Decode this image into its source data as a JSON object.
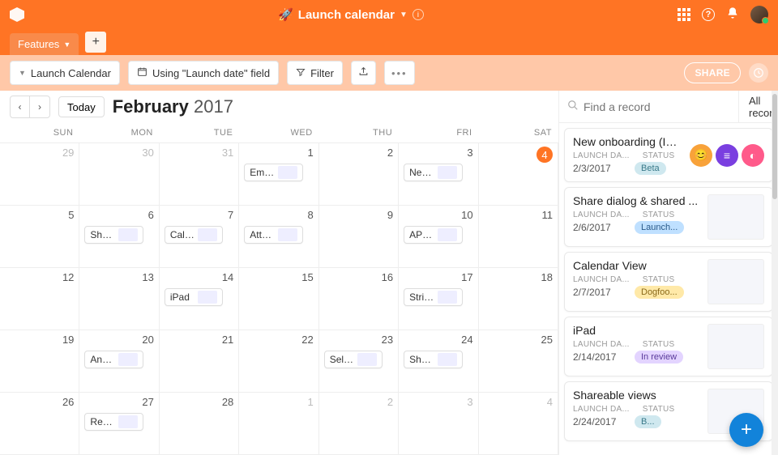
{
  "topbar": {
    "title": "Launch calendar",
    "rocket": "🚀"
  },
  "tabs": {
    "features": "Features",
    "add": "+"
  },
  "toolbar": {
    "view_name": "Launch Calendar",
    "using_field": "Using \"Launch date\" field",
    "filter": "Filter",
    "share": "SHARE"
  },
  "cal": {
    "today": "Today",
    "month": "February",
    "year": "2017",
    "dow": [
      "SUN",
      "MON",
      "TUE",
      "WED",
      "THU",
      "FRI",
      "SAT"
    ],
    "cells": [
      {
        "n": "29",
        "off": true
      },
      {
        "n": "30",
        "off": true
      },
      {
        "n": "31",
        "off": true
      },
      {
        "n": "1",
        "ev": "Embed..."
      },
      {
        "n": "2"
      },
      {
        "n": "3",
        "ev": "New o..."
      },
      {
        "n": "4",
        "today": true
      },
      {
        "n": "5"
      },
      {
        "n": "6",
        "ev": "Share ..."
      },
      {
        "n": "7",
        "ev": "Calend..."
      },
      {
        "n": "8",
        "ev": "Attach..."
      },
      {
        "n": "9"
      },
      {
        "n": "10",
        "ev": "API Im..."
      },
      {
        "n": "11"
      },
      {
        "n": "12"
      },
      {
        "n": "13"
      },
      {
        "n": "14",
        "ev": "iPad"
      },
      {
        "n": "15"
      },
      {
        "n": "16"
      },
      {
        "n": "17",
        "ev": "String ..."
      },
      {
        "n": "18"
      },
      {
        "n": "19"
      },
      {
        "n": "20",
        "ev": "Android"
      },
      {
        "n": "21"
      },
      {
        "n": "22"
      },
      {
        "n": "23",
        "ev": "Seltzer..."
      },
      {
        "n": "24",
        "ev": "Sharea..."
      },
      {
        "n": "25"
      },
      {
        "n": "26"
      },
      {
        "n": "27",
        "ev": "Reorde..."
      },
      {
        "n": "28"
      },
      {
        "n": "1",
        "off": true
      },
      {
        "n": "2",
        "off": true
      },
      {
        "n": "3",
        "off": true
      },
      {
        "n": "4",
        "off": true
      }
    ]
  },
  "sidebar": {
    "search_placeholder": "Find a record",
    "all_records": "All records",
    "launch_lbl": "LAUNCH DA...",
    "status_lbl": "STATUS",
    "records": [
      {
        "title": "New onboarding (Inter...",
        "date": "2/3/2017",
        "status": "Beta",
        "badge": "b-beta",
        "icons": true
      },
      {
        "title": "Share dialog & shared ...",
        "date": "2/6/2017",
        "status": "Launch...",
        "badge": "b-launch"
      },
      {
        "title": "Calendar View",
        "date": "2/7/2017",
        "status": "Dogfoo...",
        "badge": "b-dog"
      },
      {
        "title": "iPad",
        "date": "2/14/2017",
        "status": "In review",
        "badge": "b-rev"
      },
      {
        "title": "Shareable views",
        "date": "2/24/2017",
        "status": "B...",
        "badge": "b-beta"
      }
    ]
  }
}
